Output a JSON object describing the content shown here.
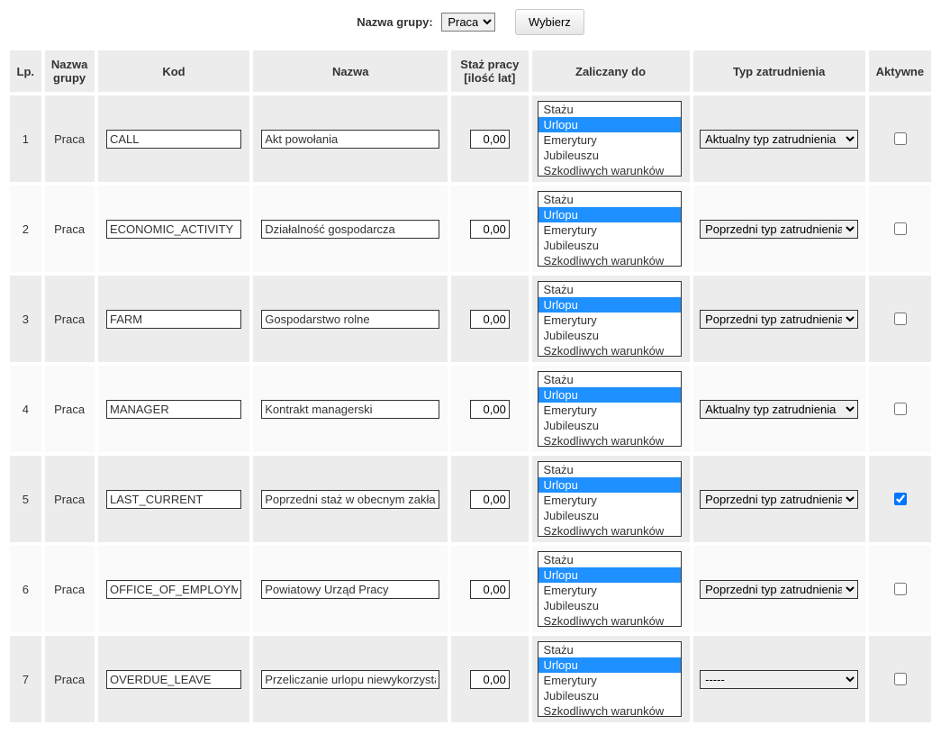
{
  "filter": {
    "label": "Nazwa grupy:",
    "selected": "Praca",
    "options": [
      "Praca"
    ],
    "button": "Wybierz"
  },
  "columns": {
    "lp": "Lp.",
    "group": "Nazwa grupy",
    "kod": "Kod",
    "nazwa": "Nazwa",
    "staz": "Staż pracy [ilość lat]",
    "zal": "Zaliczany do",
    "typ": "Typ zatrudnienia",
    "akt": "Aktywne"
  },
  "zal_options": [
    "Stażu",
    "Urlopu",
    "Emerytury",
    "Jubileuszu",
    "Szkodliwych warunków"
  ],
  "typ_options": [
    "-----",
    "Aktualny typ zatrudnienia",
    "Poprzedni typ zatrudnienia"
  ],
  "rows": [
    {
      "lp": "1",
      "group": "Praca",
      "kod": "CALL",
      "nazwa": "Akt powołania",
      "staz": "0,00",
      "zal_selected": [
        "Urlopu"
      ],
      "typ": "Aktualny typ zatrudnienia",
      "active": false
    },
    {
      "lp": "2",
      "group": "Praca",
      "kod": "ECONOMIC_ACTIVITY",
      "nazwa": "Działalność gospodarcza",
      "staz": "0,00",
      "zal_selected": [
        "Urlopu"
      ],
      "typ": "Poprzedni typ zatrudnienia",
      "active": false
    },
    {
      "lp": "3",
      "group": "Praca",
      "kod": "FARM",
      "nazwa": "Gospodarstwo rolne",
      "staz": "0,00",
      "zal_selected": [
        "Urlopu"
      ],
      "typ": "Poprzedni typ zatrudnienia",
      "active": false
    },
    {
      "lp": "4",
      "group": "Praca",
      "kod": "MANAGER",
      "nazwa": "Kontrakt managerski",
      "staz": "0,00",
      "zal_selected": [
        "Urlopu"
      ],
      "typ": "Aktualny typ zatrudnienia",
      "active": false
    },
    {
      "lp": "5",
      "group": "Praca",
      "kod": "LAST_CURRENT",
      "nazwa": "Poprzedni staż w obecnym zakładzie",
      "staz": "0,00",
      "zal_selected": [
        "Urlopu"
      ],
      "typ": "Poprzedni typ zatrudnienia",
      "active": true
    },
    {
      "lp": "6",
      "group": "Praca",
      "kod": "OFFICE_OF_EMPLOYMENT",
      "nazwa": "Powiatowy Urząd Pracy",
      "staz": "0,00",
      "zal_selected": [
        "Urlopu"
      ],
      "typ": "Poprzedni typ zatrudnienia",
      "active": false
    },
    {
      "lp": "7",
      "group": "Praca",
      "kod": "OVERDUE_LEAVE",
      "nazwa": "Przeliczanie urlopu niewykorzystanego",
      "staz": "0,00",
      "zal_selected": [
        "Urlopu"
      ],
      "typ": "-----",
      "active": false
    }
  ]
}
